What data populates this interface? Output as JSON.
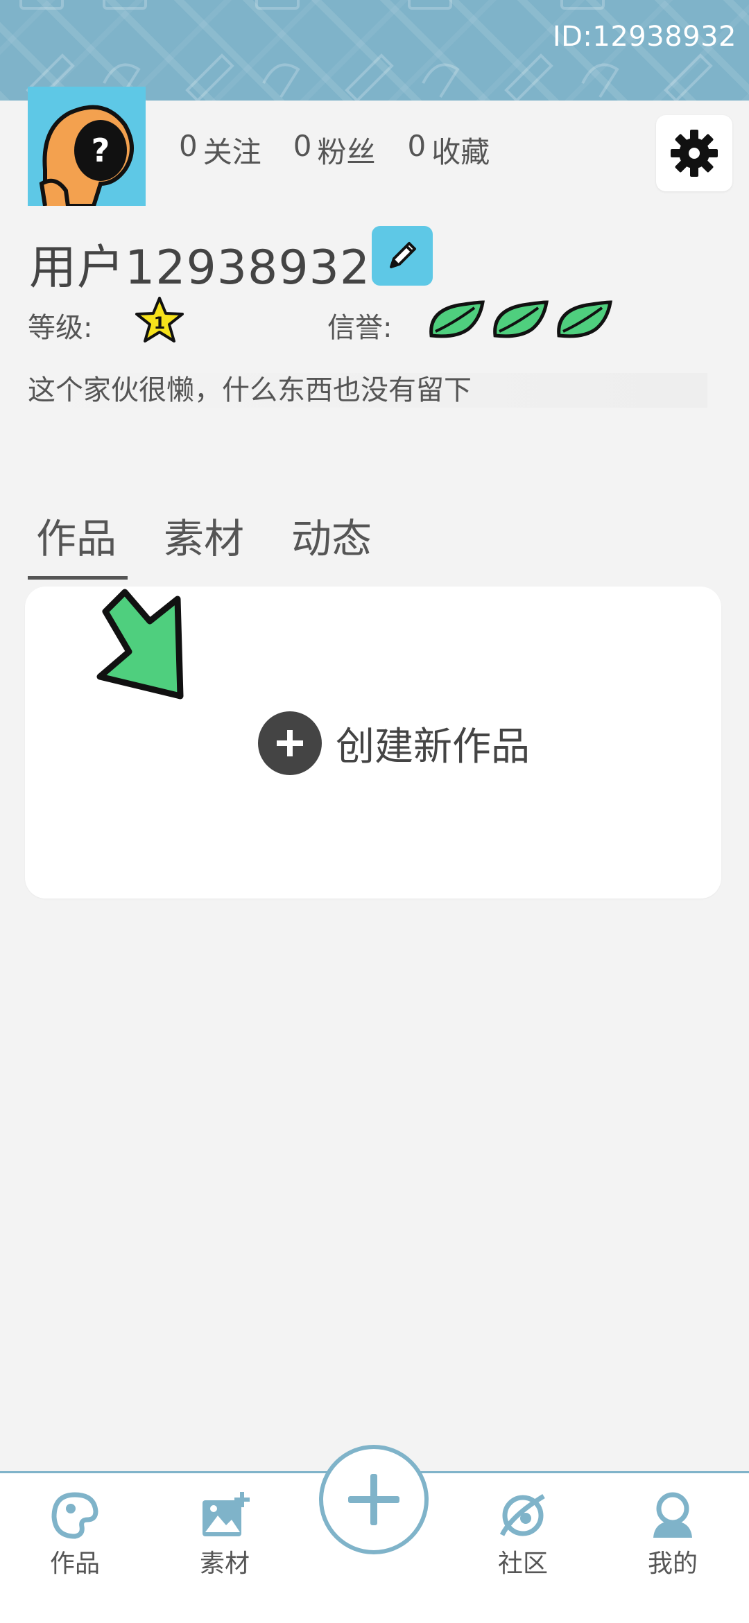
{
  "header": {
    "user_id": "ID:12938932"
  },
  "profile": {
    "stats": [
      {
        "count": "0",
        "label": "关注"
      },
      {
        "count": "0",
        "label": "粉丝"
      },
      {
        "count": "0",
        "label": "收藏"
      }
    ],
    "username": "用户12938932",
    "level_label": "等级:",
    "level_value": "1",
    "reputation_label": "信誉:",
    "reputation_leaves": 3,
    "bio": "这个家伙很懒，什么东西也没有留下"
  },
  "tabs": [
    {
      "label": "作品",
      "active": true
    },
    {
      "label": "素材",
      "active": false
    },
    {
      "label": "动态",
      "active": false
    }
  ],
  "create_card": {
    "label": "创建新作品"
  },
  "bottom_nav": {
    "works": "作品",
    "materials": "素材",
    "community": "社区",
    "mine": "我的"
  },
  "colors": {
    "header_bg": "#7fb3c9",
    "avatar_bg": "#5ec8e6",
    "accent_green": "#4fcf7e",
    "star_yellow": "#f6e21b"
  },
  "icons": {
    "settings": "gear-icon",
    "edit": "pencil-icon",
    "create": "plus-circle-icon",
    "nav_works": "palette-icon",
    "nav_materials": "image-add-icon",
    "nav_center": "plus-icon",
    "nav_community": "planet-icon",
    "nav_mine": "profile-bust-icon"
  }
}
